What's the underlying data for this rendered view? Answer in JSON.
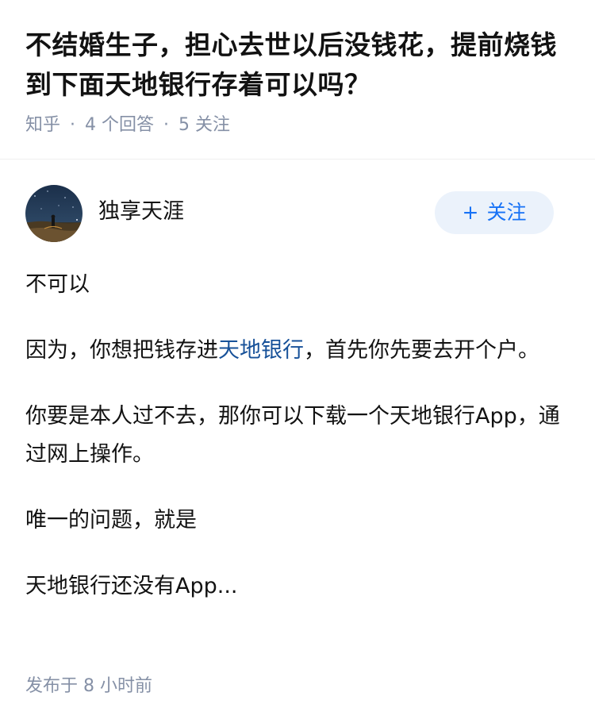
{
  "question": {
    "title": "不结婚生子，担心去世以后没钱花，提前烧钱到下面天地银行存着可以吗？",
    "source": "知乎",
    "separator": "·",
    "answer_count": "4 个回答",
    "follower_count": "5 关注"
  },
  "answer": {
    "author": {
      "name": "独享天涯",
      "avatar_icon": "night-sky-avatar",
      "follow_icon": "plus-icon",
      "follow_plus": "+",
      "follow_label": "关注"
    },
    "paragraphs": [
      {
        "text": "不可以"
      },
      {
        "before": "因为，你想把钱存进",
        "link": "天地银行",
        "after": "，首先你先要去开个户。"
      },
      {
        "text": "你要是本人过不去，那你可以下载一个天地银行App，通过网上操作。"
      },
      {
        "text": "唯一的问题，就是"
      },
      {
        "text": "天地银行还没有App..."
      }
    ],
    "publish_time": "发布于 8 小时前"
  },
  "colors": {
    "link": "#175199",
    "meta": "#8590a6",
    "follow_bg": "#ebf2fb",
    "follow_text": "#1772f6"
  }
}
